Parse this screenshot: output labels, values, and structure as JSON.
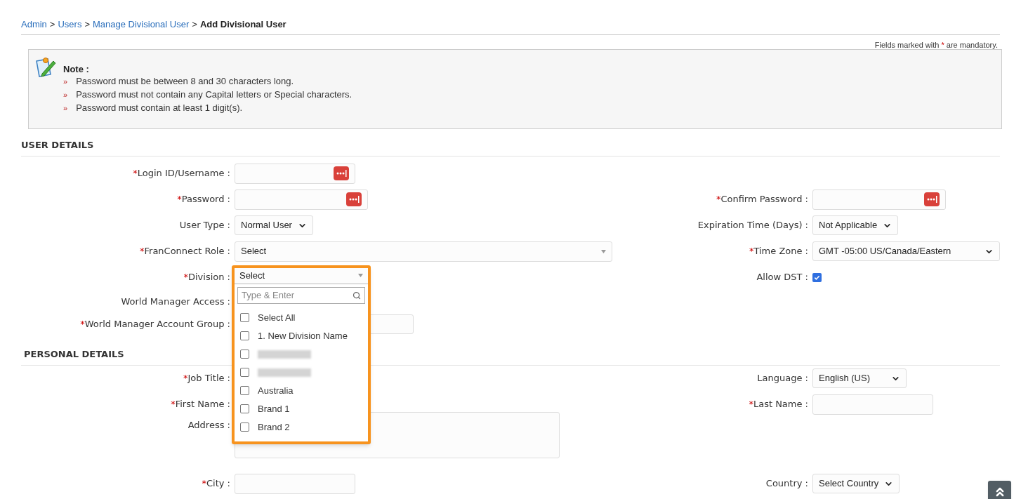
{
  "breadcrumb": [
    {
      "label": "Admin",
      "kind": "link"
    },
    {
      "label": "Users",
      "kind": "link"
    },
    {
      "label": "Manage Divisional User",
      "kind": "link"
    },
    {
      "label": "Add Divisional User",
      "kind": "current"
    }
  ],
  "separator": ">",
  "mandatory_note": {
    "before": "Fields marked with",
    "mark": "*",
    "after": "are mandatory."
  },
  "note": {
    "title": "Note :",
    "bullet": "»",
    "items": [
      "Password must be between 8 and 30 characters long.",
      "Password must not contain any Capital letters or Special characters.",
      "Password must contain at least 1 digit(s)."
    ]
  },
  "sections": [
    {
      "title": "USER DETAILS",
      "rows": [
        {
          "left": {
            "label": "Login ID/Username :",
            "required_mark": "*",
            "kind": "password_text"
          },
          "right": null
        },
        {
          "left": {
            "label": "Password :",
            "required_mark": "*",
            "kind": "password_text"
          },
          "right": {
            "label": "Confirm Password :",
            "required_mark": "*",
            "kind": "password_text"
          }
        },
        {
          "left": {
            "label": "User Type :",
            "kind": "select",
            "value": "Normal User"
          },
          "right": {
            "label": "Expiration Time (Days) :",
            "kind": "select",
            "value": "Not Applicable"
          }
        },
        {
          "left": {
            "label": "FranConnect Role :",
            "required_mark": "*",
            "kind": "combo",
            "value": "Select"
          },
          "right": {
            "label": "Time Zone :",
            "required_mark": "*",
            "kind": "select",
            "value": "GMT -05:00 US/Canada/Eastern"
          }
        },
        {
          "left": {
            "label": "Division :",
            "required_mark": "*",
            "kind": "multiselect",
            "value": "Select",
            "search_placeholder": "Type & Enter",
            "expanded": true,
            "options": [
              {
                "kind": "option",
                "label": "Select All",
                "checked": false
              },
              {
                "kind": "option",
                "label": "1. New Division Name",
                "checked": false
              },
              {
                "kind": "redacted",
                "checked": false
              },
              {
                "kind": "redacted",
                "checked": false
              },
              {
                "kind": "option",
                "label": "Australia",
                "checked": false
              },
              {
                "kind": "option",
                "label": "Brand 1",
                "checked": false
              },
              {
                "kind": "option",
                "label": "Brand 2",
                "checked": false
              }
            ]
          },
          "right": {
            "label": "Allow DST :",
            "kind": "checkbox",
            "checked": true
          }
        },
        {
          "left": {
            "label": "World Manager Access :",
            "kind": "hidden"
          },
          "right": null
        },
        {
          "left": {
            "label": "World Manager Account Group :",
            "required_mark": "*",
            "kind": "select"
          },
          "right": null
        }
      ]
    },
    {
      "title": "PERSONAL DETAILS",
      "rows": [
        {
          "left": {
            "label": "Job Title :",
            "required_mark": "*",
            "kind": "hidden"
          },
          "right": {
            "label": "Language :",
            "kind": "select",
            "value": "English (US)"
          }
        },
        {
          "left": {
            "label": "First Name :",
            "required_mark": "*",
            "kind": "hidden"
          },
          "right": {
            "label": "Last Name :",
            "required_mark": "*",
            "kind": "text"
          }
        },
        {
          "left": {
            "label": "Address :",
            "kind": "textarea"
          },
          "right": null
        },
        {
          "left": {
            "label": "City :",
            "required_mark": "*",
            "kind": "text"
          },
          "right": {
            "label": "Country :",
            "kind": "select",
            "value": "Select Country"
          }
        }
      ]
    }
  ]
}
